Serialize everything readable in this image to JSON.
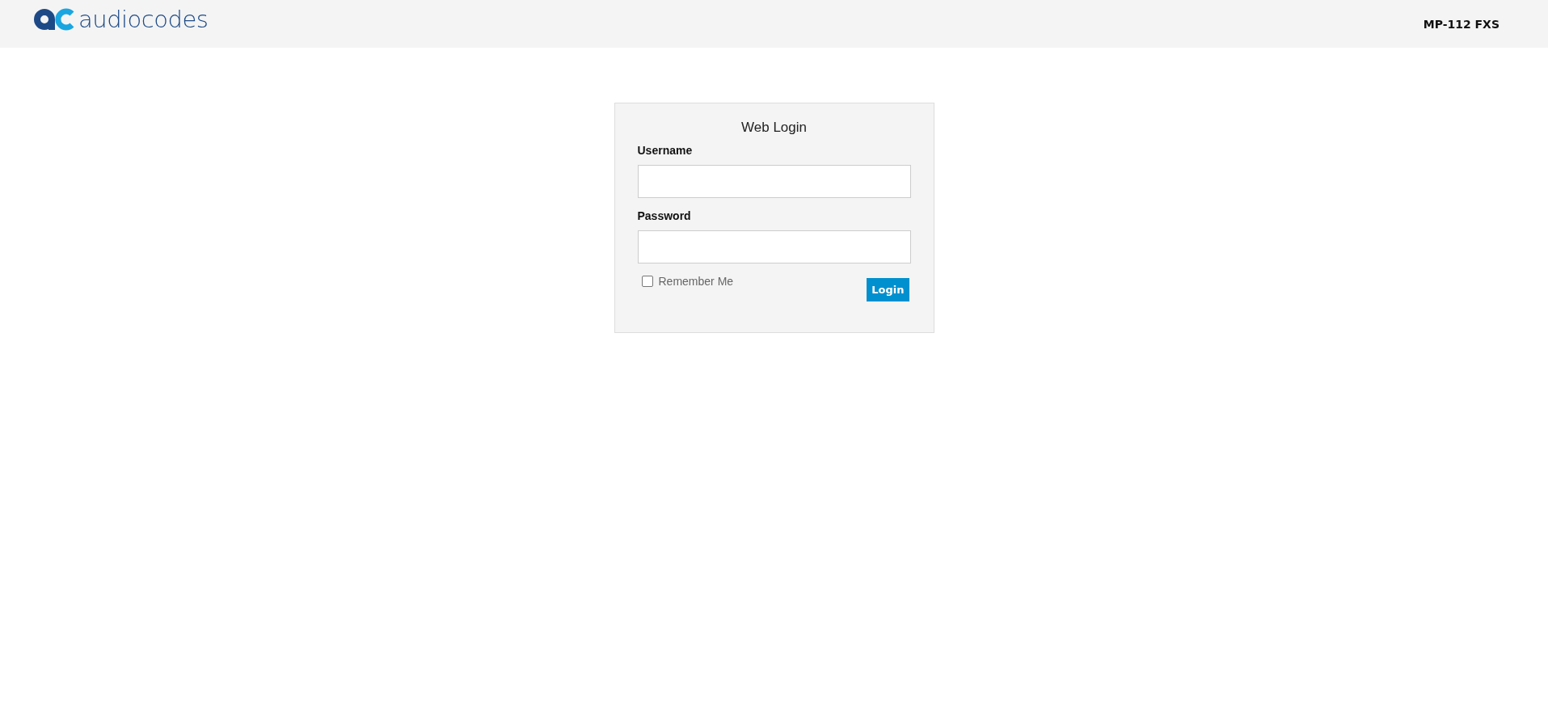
{
  "header": {
    "logo_text": "audiocodes",
    "device": "MP-112 FXS"
  },
  "login": {
    "title": "Web Login",
    "fields": [
      {
        "label": "Username"
      },
      {
        "label": "Password"
      }
    ],
    "remember": {
      "label": "Remember Me",
      "checked": false
    },
    "button": "Login"
  }
}
